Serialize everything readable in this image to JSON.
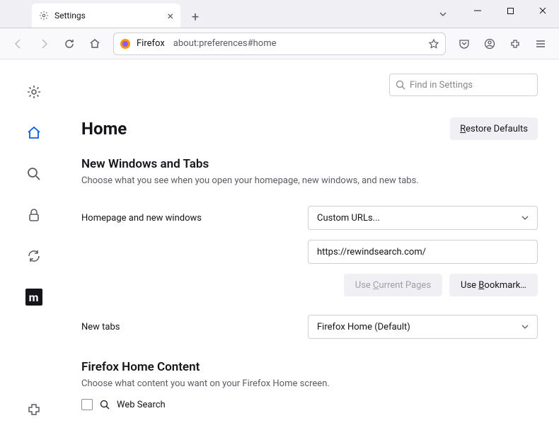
{
  "tab": {
    "title": "Settings"
  },
  "urlbar": {
    "brand": "Firefox",
    "url": "about:preferences#home"
  },
  "search": {
    "placeholder": "Find in Settings"
  },
  "page": {
    "title": "Home",
    "restore": "Restore Defaults",
    "section1_title": "New Windows and Tabs",
    "section1_desc": "Choose what you see when you open your homepage, new windows, and new tabs.",
    "homepage_label": "Homepage and new windows",
    "homepage_select": "Custom URLs...",
    "homepage_url": "https://rewindsearch.com/",
    "use_current": "Use Current Pages",
    "use_bookmark": "Use Bookmark…",
    "newtabs_label": "New tabs",
    "newtabs_select": "Firefox Home (Default)",
    "section2_title": "Firefox Home Content",
    "section2_desc": "Choose what content you want on your Firefox Home screen.",
    "websearch": "Web Search"
  }
}
